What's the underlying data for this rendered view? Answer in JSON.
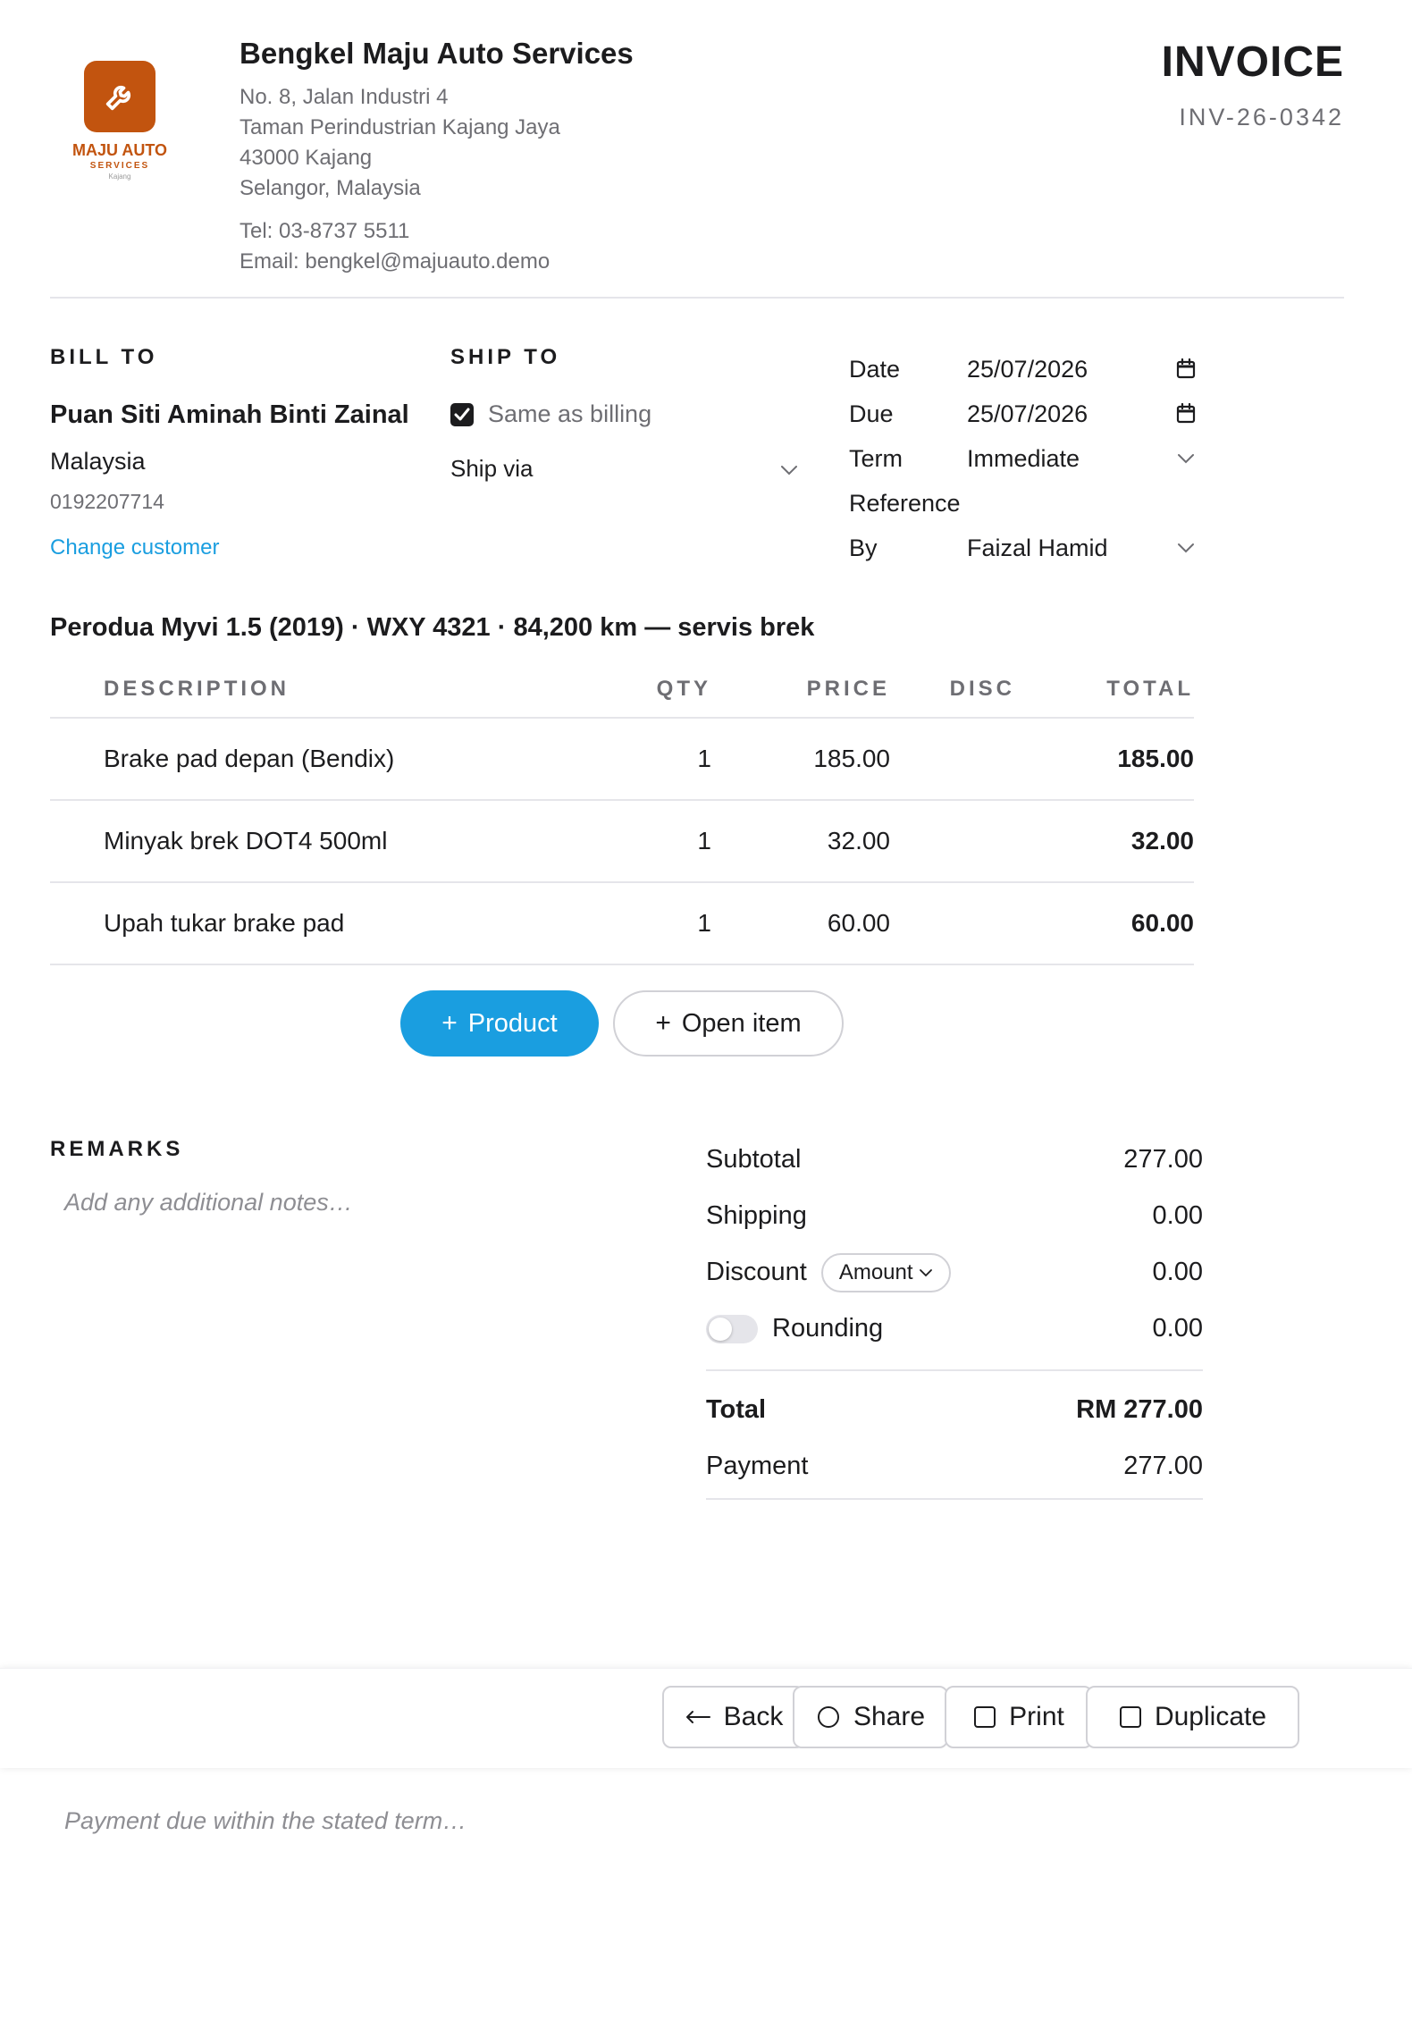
{
  "logo": {
    "name": "MAJU AUTO",
    "sub": "SERVICES",
    "location": "Kajang",
    "color": "#c2540f",
    "icon": "wrench-icon"
  },
  "company": {
    "name": "Bengkel Maju Auto Services",
    "address": [
      "No. 8, Jalan Industri 4",
      "Taman Perindustrian Kajang Jaya",
      "43000 Kajang",
      "Selangor, Malaysia"
    ],
    "tel": "Tel: 03-8737 5511",
    "email": "Email: bengkel@majuauto.demo"
  },
  "invoice": {
    "title": "INVOICE",
    "number": "INV-26-0342"
  },
  "bill_to": {
    "label": "BILL TO",
    "name": "Puan Siti Aminah Binti Zainal",
    "country": "Malaysia",
    "phone": "0192207714",
    "change_link": "Change customer"
  },
  "ship_to": {
    "label": "SHIP TO",
    "same_as_billing": "Same as billing",
    "same_checked": true,
    "ship_via": "Ship via"
  },
  "meta": {
    "date_label": "Date",
    "date": "25/07/2026",
    "due_label": "Due",
    "due": "25/07/2026",
    "term_label": "Term",
    "term": "Immediate",
    "reference_label": "Reference",
    "reference": "",
    "by_label": "By",
    "by": "Faizal Hamid"
  },
  "vehicle": "Perodua Myvi 1.5 (2019) · WXY 4321 · 84,200 km — servis brek",
  "table": {
    "headers": {
      "description": "DESCRIPTION",
      "qty": "QTY",
      "price": "PRICE",
      "disc": "DISC",
      "total": "TOTAL"
    },
    "rows": [
      {
        "description": "Brake pad depan (Bendix)",
        "qty": "1",
        "price": "185.00",
        "disc": "",
        "total": "185.00"
      },
      {
        "description": "Minyak brek DOT4 500ml",
        "qty": "1",
        "price": "32.00",
        "disc": "",
        "total": "32.00"
      },
      {
        "description": "Upah tukar brake pad",
        "qty": "1",
        "price": "60.00",
        "disc": "",
        "total": "60.00"
      }
    ]
  },
  "buttons": {
    "product": "Product",
    "open_item": "Open item",
    "plus": "+"
  },
  "remarks": {
    "label": "REMARKS",
    "placeholder": "Add any additional notes…"
  },
  "totals": {
    "subtotal_label": "Subtotal",
    "subtotal": "277.00",
    "shipping_label": "Shipping",
    "shipping": "0.00",
    "discount_label": "Discount",
    "discount_type": "Amount",
    "discount": "0.00",
    "rounding_label": "Rounding",
    "rounding": "0.00",
    "rounding_on": false,
    "total_label": "Total",
    "total": "RM 277.00",
    "payment_label": "Payment",
    "payment": "277.00"
  },
  "footer": {
    "back": "Back",
    "share": "Share",
    "print": "Print",
    "duplicate": "Duplicate",
    "terms_placeholder": "Payment due within the stated term…"
  },
  "colors": {
    "accent": "#1a9ee0",
    "brand": "#c2540f"
  }
}
